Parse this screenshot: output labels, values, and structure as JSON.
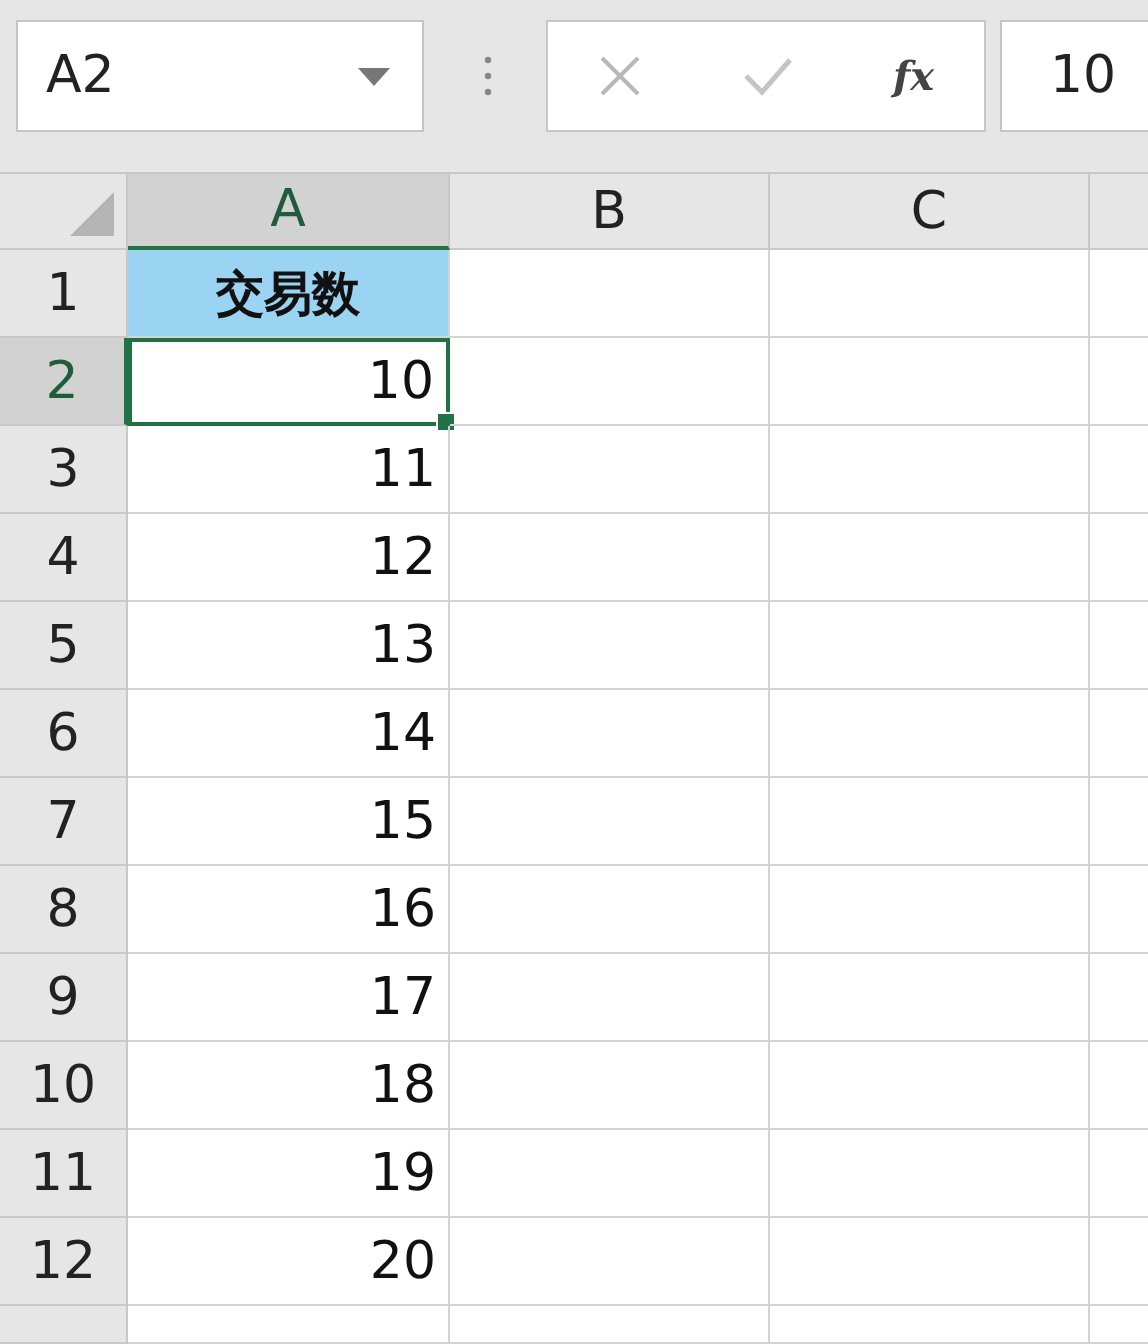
{
  "name_box": {
    "value": "A2"
  },
  "formula_bar": {
    "function_label": "fx",
    "value": "10"
  },
  "columns": [
    {
      "label": "A",
      "selected": true
    },
    {
      "label": "B",
      "selected": false
    },
    {
      "label": "C",
      "selected": false
    }
  ],
  "rows": [
    {
      "number": "1",
      "selected": false,
      "kind": "heading",
      "a": "交易数"
    },
    {
      "number": "2",
      "selected": true,
      "kind": "number",
      "a": "10"
    },
    {
      "number": "3",
      "selected": false,
      "kind": "number",
      "a": "11"
    },
    {
      "number": "4",
      "selected": false,
      "kind": "number",
      "a": "12"
    },
    {
      "number": "5",
      "selected": false,
      "kind": "number",
      "a": "13"
    },
    {
      "number": "6",
      "selected": false,
      "kind": "number",
      "a": "14"
    },
    {
      "number": "7",
      "selected": false,
      "kind": "number",
      "a": "15"
    },
    {
      "number": "8",
      "selected": false,
      "kind": "number",
      "a": "16"
    },
    {
      "number": "9",
      "selected": false,
      "kind": "number",
      "a": "17"
    },
    {
      "number": "10",
      "selected": false,
      "kind": "number",
      "a": "18"
    },
    {
      "number": "11",
      "selected": false,
      "kind": "number",
      "a": "19"
    },
    {
      "number": "12",
      "selected": false,
      "kind": "number",
      "a": "20"
    }
  ]
}
